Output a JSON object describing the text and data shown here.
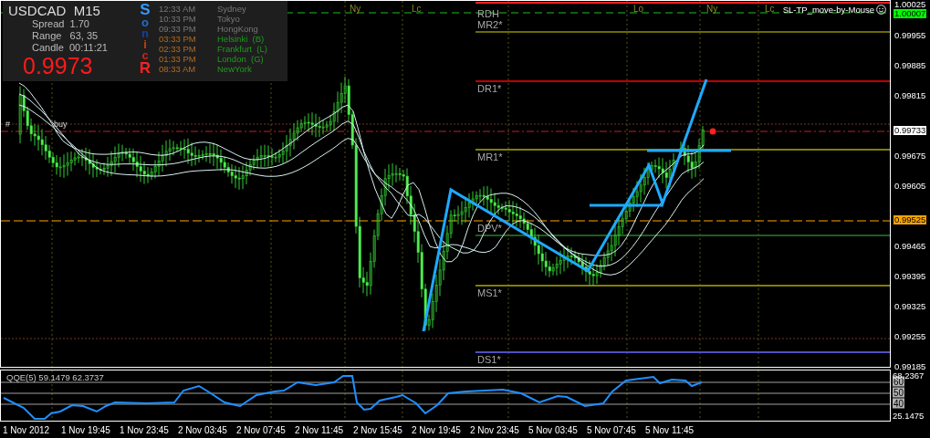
{
  "chart_info": {
    "symbol": "USDCAD",
    "timeframe": "M15",
    "spread_label": "Spread",
    "spread": "1.70",
    "range_label": "Range",
    "range": "63, 35",
    "candle_label": "Candle",
    "candle_timer": "00:11:21",
    "price": "0.9973"
  },
  "vertical_letters": [
    {
      "text": "S",
      "color": "#3399ff"
    },
    {
      "text": "o",
      "color": "#1e6fd0"
    },
    {
      "text": "n",
      "color": "#1a3f9a"
    },
    {
      "text": "i",
      "color": "#c04010"
    },
    {
      "text": "c",
      "color": "#d02020"
    },
    {
      "text": "R",
      "color": "#ff2020"
    }
  ],
  "sessions": [
    {
      "time": "12:33 AM",
      "city": "Sydney",
      "open": false
    },
    {
      "time": "10:33 PM",
      "city": "Tokyo",
      "open": false
    },
    {
      "time": "09:33 PM",
      "city": "HongKong",
      "open": false
    },
    {
      "time": "03:33 PM",
      "city": "Helsinki  (B)",
      "open": true
    },
    {
      "time": "02:33 PM",
      "city": "Frankfurt  (L)",
      "open": true
    },
    {
      "time": "01:33 PM",
      "city": "London  (G)",
      "open": true
    },
    {
      "time": "08:33 AM",
      "city": "NewYork",
      "open": true
    }
  ],
  "session_markers": [
    "Ny",
    "Lc",
    "Lo",
    "Ny",
    "Lc"
  ],
  "pivot_levels": [
    {
      "label": "RDH",
      "color": "#ff2020"
    },
    {
      "label": "MR2*",
      "color": "#6b6b00"
    },
    {
      "label": "DR1*",
      "color": "#c00000"
    },
    {
      "label": "MR1*",
      "color": "#808000"
    },
    {
      "label": "DPV*",
      "color": "#1f5f1f"
    },
    {
      "label": "MS1*",
      "color": "#808000"
    },
    {
      "label": "DS1*",
      "color": "#5050c0"
    }
  ],
  "order_label": {
    "prefix": "#",
    "text": "buy"
  },
  "script_label": "SL-TP_move-by-Mouse",
  "price_axis": {
    "ticks": [
      "1.00025",
      "0.99955",
      "0.99885",
      "0.99815",
      "0.99675",
      "0.99605",
      "0.99465",
      "0.99395",
      "0.99325",
      "0.99255",
      "0.99185"
    ],
    "markers": [
      {
        "text": "1.00007",
        "color": "#00ff00"
      },
      {
        "text": "0.99733",
        "color": "#ffffff"
      },
      {
        "text": "0.99525",
        "color": "#ffa500"
      }
    ]
  },
  "indicator": {
    "label": "QQE(5) 59.1479 62.3737",
    "max": "68.2367",
    "min": "25.1475",
    "levels": [
      "60",
      "50",
      "40"
    ]
  },
  "time_axis": [
    "1 Nov 2012",
    "1 Nov 19:45",
    "1 Nov 23:45",
    "2 Nov 03:45",
    "2 Nov 07:45",
    "2 Nov 11:45",
    "2 Nov 15:45",
    "2 Nov 19:45",
    "2 Nov 23:45",
    "5 Nov 03:45",
    "5 Nov 07:45",
    "5 Nov 11:45"
  ]
}
